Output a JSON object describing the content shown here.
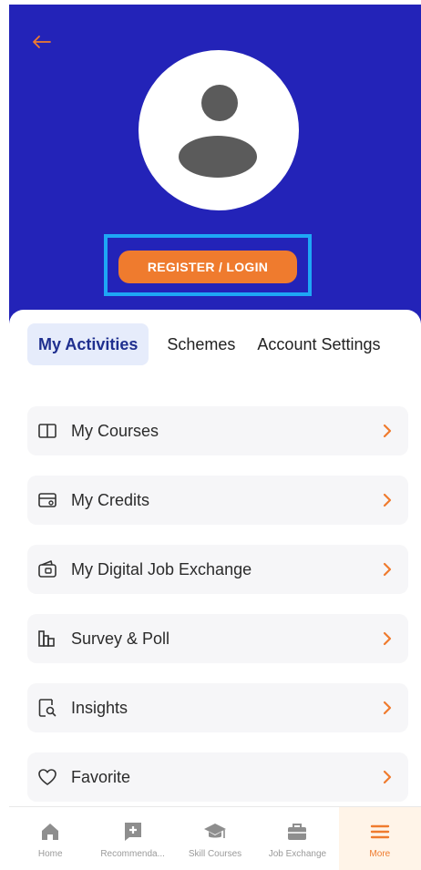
{
  "header": {
    "login_button_label": "REGISTER / LOGIN",
    "background_color": "#2323b8",
    "accent_color": "#ef7b2e",
    "back_icon": "arrow-left-icon",
    "avatar_icon": "user-avatar-icon"
  },
  "tabs": [
    {
      "label": "My Activities",
      "active": true
    },
    {
      "label": "Schemes",
      "active": false
    },
    {
      "label": "Account Settings",
      "active": false
    }
  ],
  "menu": [
    {
      "label": "My Courses",
      "icon": "book-icon"
    },
    {
      "label": "My Credits",
      "icon": "credit-card-icon"
    },
    {
      "label": "My Digital Job Exchange",
      "icon": "wallet-icon"
    },
    {
      "label": "Survey & Poll",
      "icon": "bar-chart-icon"
    },
    {
      "label": "Insights",
      "icon": "document-search-icon"
    },
    {
      "label": "Favorite",
      "icon": "heart-icon"
    }
  ],
  "bottom_nav": [
    {
      "label": "Home",
      "icon": "home-icon",
      "active": false
    },
    {
      "label": "Recommenda...",
      "icon": "recommend-icon",
      "active": false
    },
    {
      "label": "Skill Courses",
      "icon": "graduation-cap-icon",
      "active": false
    },
    {
      "label": "Job Exchange",
      "icon": "briefcase-icon",
      "active": false
    },
    {
      "label": "More",
      "icon": "menu-icon",
      "active": true
    }
  ]
}
